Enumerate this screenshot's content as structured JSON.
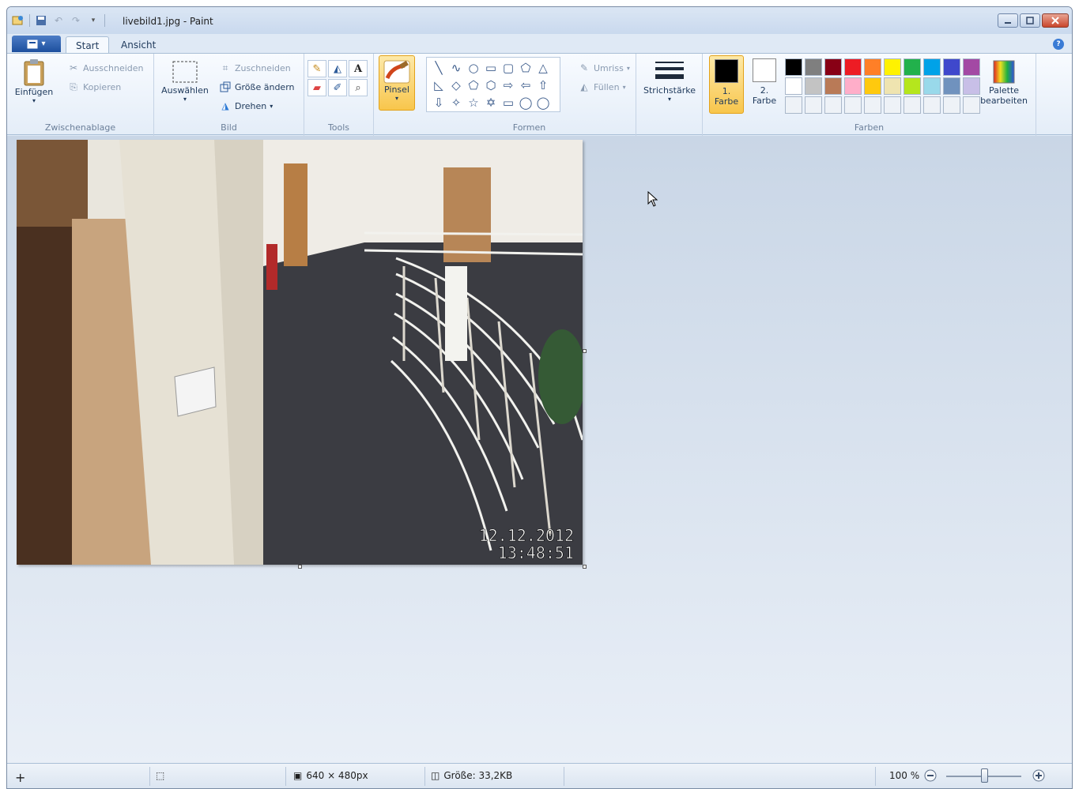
{
  "window": {
    "title": "livebild1.jpg - Paint"
  },
  "tabs": [
    {
      "label": "Start"
    },
    {
      "label": "Ansicht"
    }
  ],
  "ribbon": {
    "clipboard": {
      "paste": "Einfügen",
      "cut": "Ausschneiden",
      "copy": "Kopieren",
      "group": "Zwischenablage"
    },
    "image": {
      "select": "Auswählen",
      "crop": "Zuschneiden",
      "resize": "Größe ändern",
      "rotate": "Drehen",
      "group": "Bild"
    },
    "tools": {
      "group": "Tools"
    },
    "brush": {
      "label": "Pinsel"
    },
    "shapes": {
      "outline": "Umriss",
      "fill": "Füllen",
      "group": "Formen"
    },
    "stroke": {
      "label": "Strichstärke"
    },
    "colors": {
      "color1_line1": "1.",
      "color1_line2": "Farbe",
      "color2_line1": "2.",
      "color2_line2": "Farbe",
      "edit_line1": "Palette",
      "edit_line2": "bearbeiten",
      "group": "Farben",
      "color1_value": "#000000",
      "color2_value": "#ffffff",
      "palette": [
        "#000000",
        "#7f7f7f",
        "#880015",
        "#ed1c24",
        "#ff7f27",
        "#fff200",
        "#22b14c",
        "#00a2e8",
        "#3f48cc",
        "#a349a4",
        "#ffffff",
        "#c3c3c3",
        "#b97a57",
        "#ffaec9",
        "#ffc90e",
        "#efe4b0",
        "#b5e61d",
        "#99d9ea",
        "#7092be",
        "#c8bfe7",
        "",
        "",
        "",
        "",
        "",
        "",
        "",
        "",
        "",
        ""
      ]
    }
  },
  "canvas": {
    "timestamp_date": "12.12.2012",
    "timestamp_time": "13:48:51"
  },
  "status": {
    "dimensions": "640 × 480px",
    "size": "Größe: 33,2KB",
    "zoom": "100 %"
  }
}
